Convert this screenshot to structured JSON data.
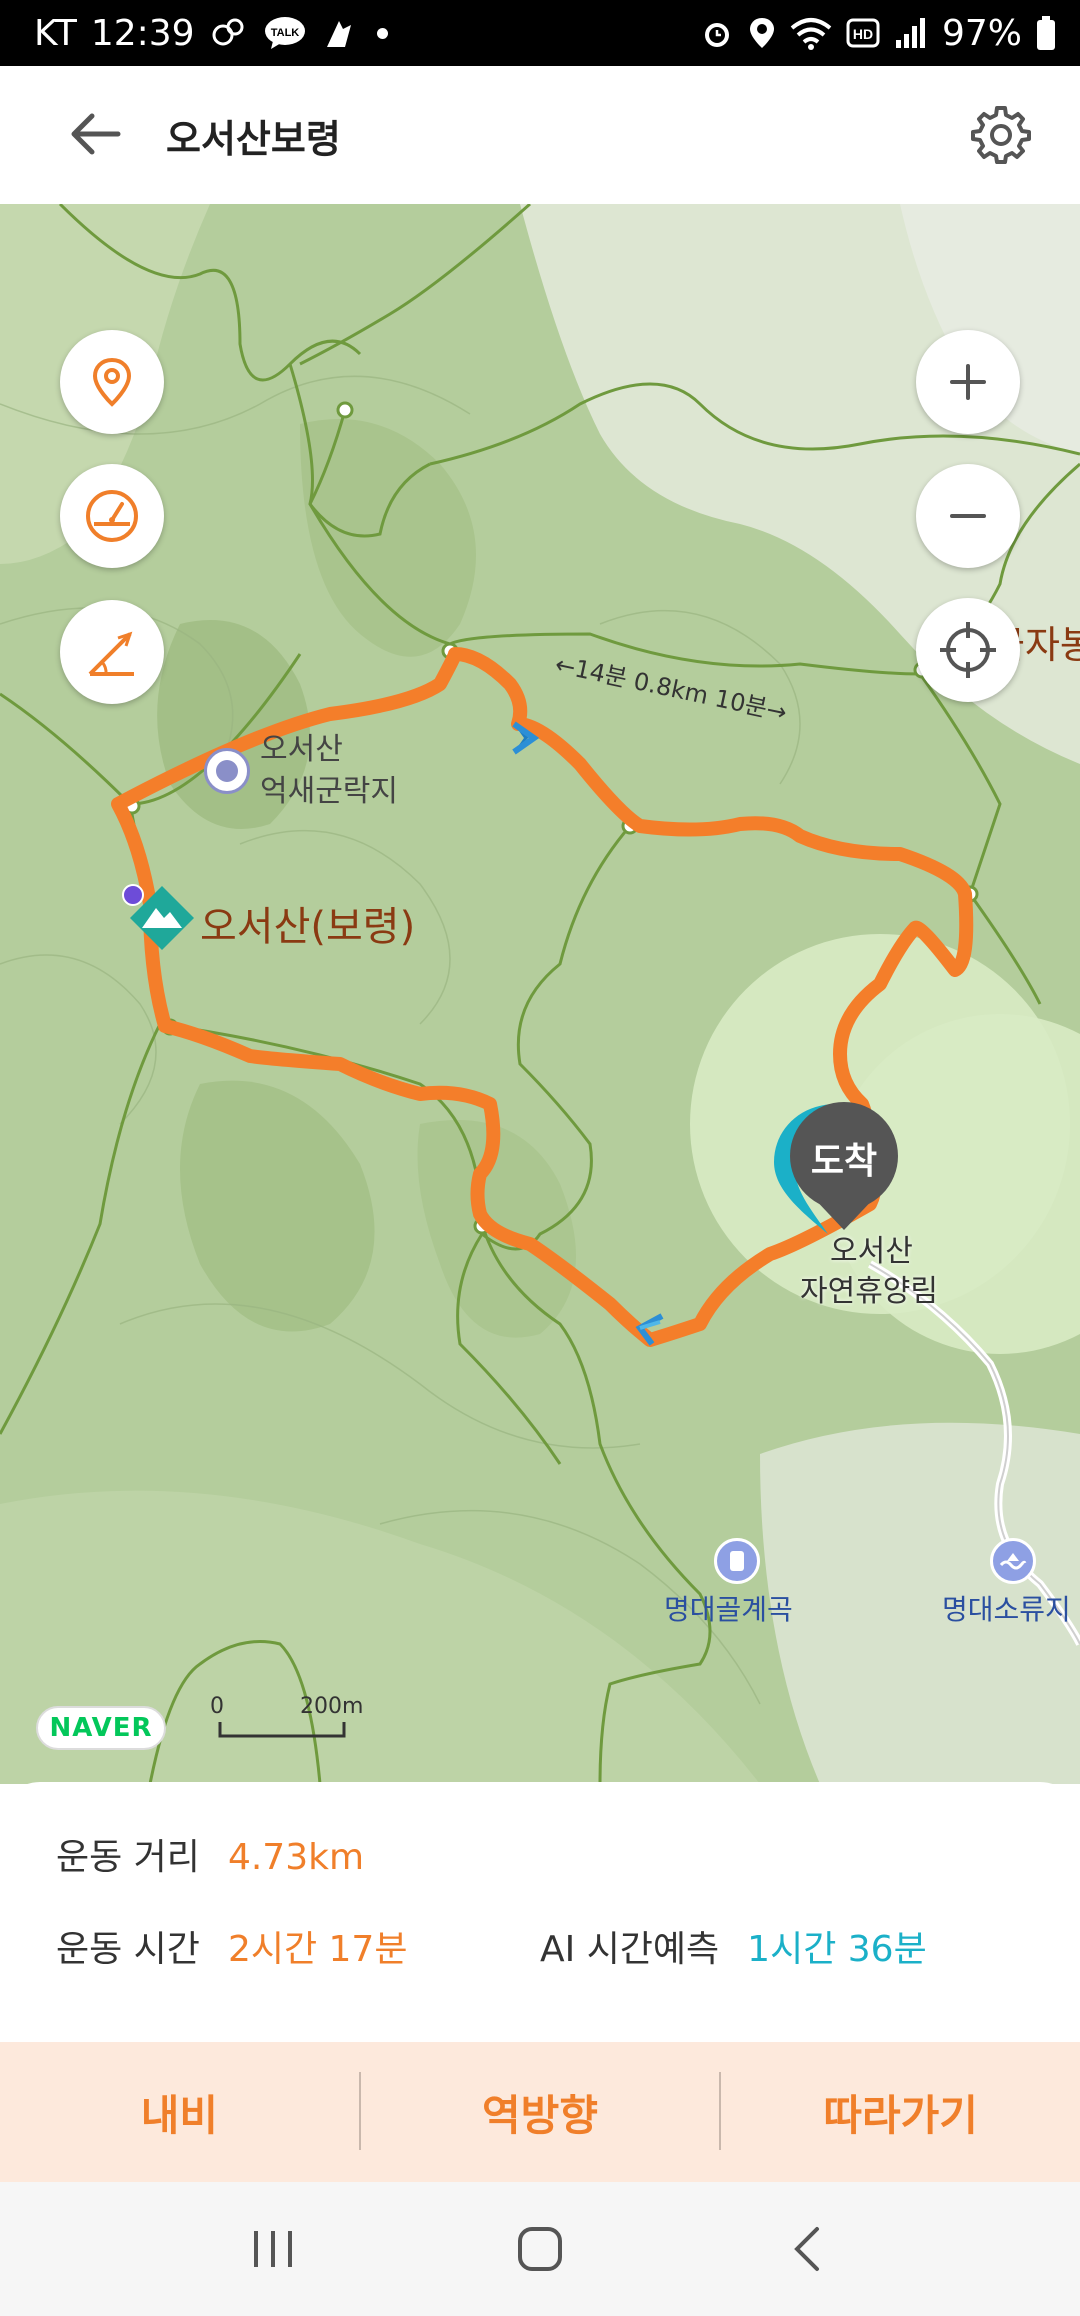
{
  "status_bar": {
    "carrier": "KT",
    "time": "12:39",
    "talk_icon_text": "TALK",
    "battery": "97%"
  },
  "header": {
    "title": "오서산보령",
    "back_icon": "arrow-left-icon",
    "settings_icon": "gear-icon"
  },
  "map": {
    "labels": {
      "peak": "오서산(보령)",
      "camp_top": "오서산",
      "camp": "억새군락지",
      "forest_line1": "오서산",
      "forest_line2": "자연휴양림",
      "valley": "명대골계곡",
      "reservoir": "명대소류지",
      "trail_info": "←14분 0.8km 10분→",
      "edge_label": "금자봉",
      "arrival_pin": "도착"
    },
    "scale": {
      "zero": "0",
      "distance": "200m"
    },
    "logo": "NAVER",
    "colors": {
      "route": "#f07f2a",
      "trail": "#6f9a3e",
      "accent": "#1bb0c8"
    }
  },
  "stats": {
    "distance_label": "운동 거리",
    "distance_value": "4.73km",
    "time_label": "운동 시간",
    "time_value": "2시간 17분",
    "ai_label": "AI 시간예측",
    "ai_value": "1시간 36분"
  },
  "actions": {
    "navigate": "내비",
    "reverse": "역방향",
    "follow": "따라가기"
  }
}
